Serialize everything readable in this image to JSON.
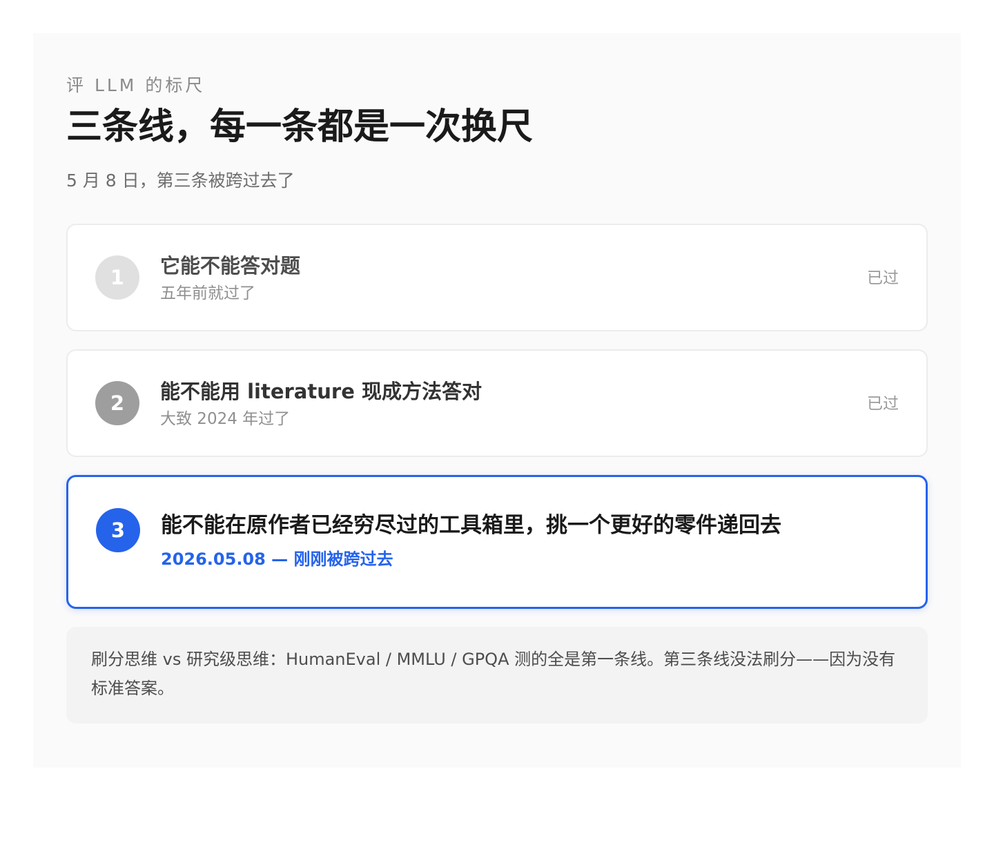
{
  "header": {
    "eyebrow": "评 LLM 的标尺",
    "title": "三条线，每一条都是一次换尺",
    "subtitle": "5 月 8 日，第三条被跨过去了"
  },
  "steps": [
    {
      "number": "1",
      "title": "它能不能答对题",
      "note": "五年前就过了",
      "status": "已过"
    },
    {
      "number": "2",
      "title": "能不能用 literature 现成方法答对",
      "note": "大致 2024 年过了",
      "status": "已过"
    },
    {
      "number": "3",
      "title": "能不能在原作者已经穷尽过的工具箱里，挑一个更好的零件递回去",
      "note": "2026.05.08 — 刚刚被跨过去"
    }
  ],
  "callout": {
    "text": "刷分思维 vs 研究级思维：HumanEval / MMLU / GPQA 测的全是第一条线。第三条线没法刷分——因为没有标准答案。"
  },
  "colors": {
    "accent": "#2563eb",
    "step1_badge": "#e0e0e0",
    "step2_badge": "#9e9e9e",
    "panel_bg": "#fafafa",
    "callout_bg": "#f3f3f3"
  }
}
